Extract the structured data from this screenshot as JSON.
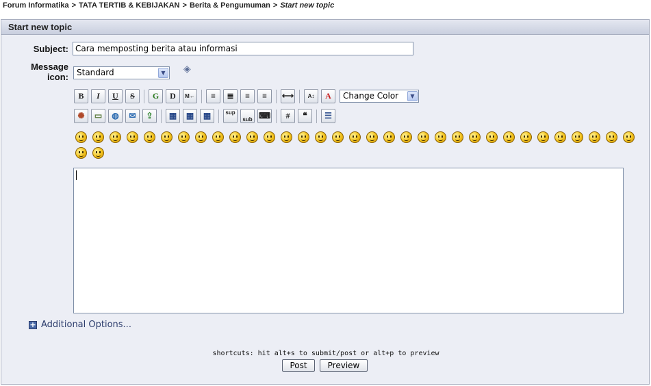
{
  "breadcrumb": {
    "items": [
      "Forum Informatika",
      "TATA TERTIB & KEBIJAKAN",
      "Berita & Pengumuman"
    ],
    "separator": ">",
    "current": "Start new topic"
  },
  "panel": {
    "title": "Start new topic"
  },
  "form": {
    "subject_label": "Subject:",
    "subject_value": "Cara memposting berita atau informasi",
    "message_icon_label_line1": "Message",
    "message_icon_label_line2": "icon:",
    "message_icon_selected": "Standard",
    "message_icon_preview": "icon-preview-icon"
  },
  "toolbar": {
    "row1": [
      {
        "name": "bold-button",
        "glyph": "B"
      },
      {
        "name": "italic-button",
        "glyph": "I"
      },
      {
        "name": "underline-button",
        "glyph": "U"
      },
      {
        "name": "strikethrough-button",
        "glyph": "S"
      },
      {
        "name": "glow-button",
        "glyph": "G"
      },
      {
        "name": "shadow-button",
        "glyph": "D"
      },
      {
        "name": "marquee-button",
        "glyph": "M←"
      },
      {
        "name": "align-left-button",
        "glyph": "≡"
      },
      {
        "name": "justify-button",
        "glyph": "≣"
      },
      {
        "name": "align-center-button",
        "glyph": "≡"
      },
      {
        "name": "align-right-button",
        "glyph": "≡"
      },
      {
        "name": "horizontal-rule-button",
        "glyph": "⟷"
      },
      {
        "name": "font-size-button",
        "glyph": "A↕"
      },
      {
        "name": "font-color-button",
        "glyph": "A"
      }
    ],
    "color_select": "Change Color",
    "row2": [
      {
        "name": "flash-button",
        "glyph": "✺"
      },
      {
        "name": "image-button",
        "glyph": "▭"
      },
      {
        "name": "hyperlink-button",
        "glyph": "◍"
      },
      {
        "name": "email-button",
        "glyph": "✉"
      },
      {
        "name": "ftp-button",
        "glyph": "⇪"
      },
      {
        "name": "table-button",
        "glyph": "▦"
      },
      {
        "name": "table-row-button",
        "glyph": "▦"
      },
      {
        "name": "table-column-button",
        "glyph": "▦"
      },
      {
        "name": "superscript-button",
        "glyph": "sup"
      },
      {
        "name": "subscript-button",
        "glyph": "sub"
      },
      {
        "name": "teletype-button",
        "glyph": "⌨"
      },
      {
        "name": "code-button",
        "glyph": "#"
      },
      {
        "name": "quote-button",
        "glyph": "❝"
      },
      {
        "name": "list-button",
        "glyph": "☰"
      }
    ]
  },
  "smilies_count": 35,
  "editor": {
    "value": ""
  },
  "additional_options": "Additional Options...",
  "shortcuts": "shortcuts: hit alt+s to submit/post or alt+p to preview",
  "buttons": {
    "post": "Post",
    "preview": "Preview"
  },
  "colors": {
    "panel_bg": "#eceef5",
    "header_bg": "#c9cfdf",
    "link": "#2c3c6c"
  }
}
